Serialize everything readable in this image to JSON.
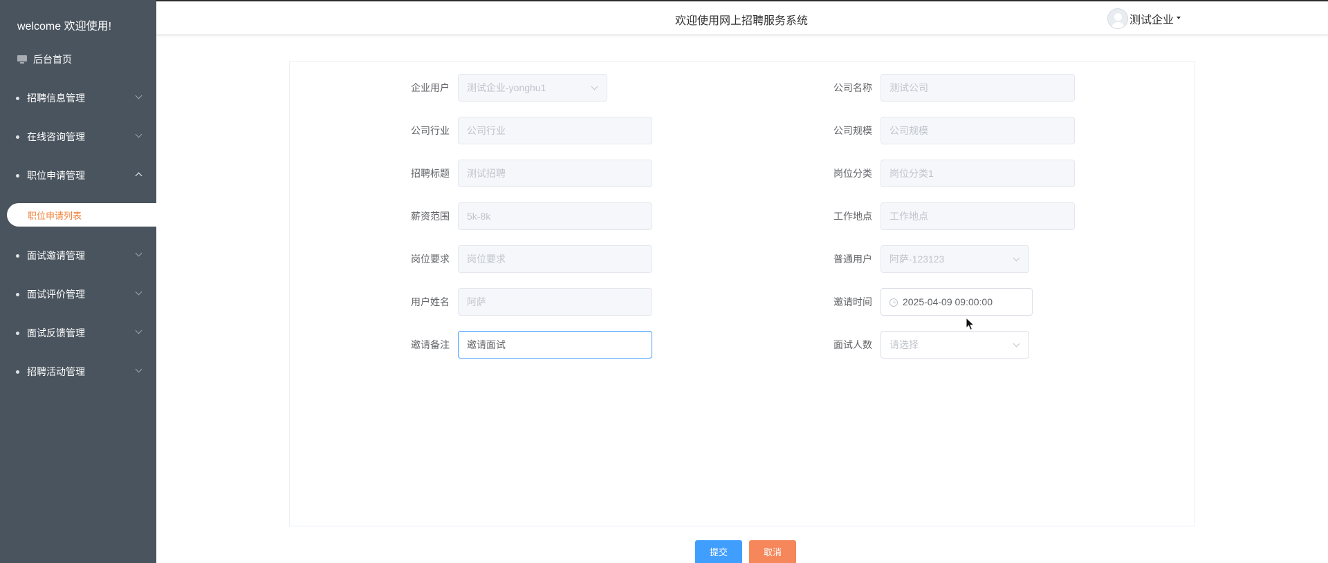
{
  "sidebar": {
    "welcome": "welcome 欢迎使用!",
    "home": "后台首页",
    "menus": [
      {
        "label": "招聘信息管理",
        "expanded": false
      },
      {
        "label": "在线咨询管理",
        "expanded": false
      },
      {
        "label": "职位申请管理",
        "expanded": true
      },
      {
        "label": "面试邀请管理",
        "expanded": false
      },
      {
        "label": "面试评价管理",
        "expanded": false
      },
      {
        "label": "面试反馈管理",
        "expanded": false
      },
      {
        "label": "招聘活动管理",
        "expanded": false
      }
    ],
    "active_sub": "职位申请列表"
  },
  "header": {
    "title": "欢迎使用网上招聘服务系统",
    "user": "测试企业"
  },
  "form": {
    "left": [
      {
        "label": "企业用户",
        "value": "测试企业-yonghu1",
        "type": "select",
        "state": "disabled"
      },
      {
        "label": "公司行业",
        "value": "公司行业",
        "type": "input",
        "state": "placeholder"
      },
      {
        "label": "招聘标题",
        "value": "测试招聘",
        "type": "input",
        "state": "disabled"
      },
      {
        "label": "薪资范围",
        "value": "5k-8k",
        "type": "input",
        "state": "disabled"
      },
      {
        "label": "岗位要求",
        "value": "岗位要求",
        "type": "input",
        "state": "placeholder"
      },
      {
        "label": "用户姓名",
        "value": "阿萨",
        "type": "input",
        "state": "disabled"
      },
      {
        "label": "邀请备注",
        "value": "邀请面试",
        "type": "input",
        "state": "active"
      }
    ],
    "right": [
      {
        "label": "公司名称",
        "value": "测试公司",
        "type": "input",
        "state": "disabled"
      },
      {
        "label": "公司规模",
        "value": "公司规模",
        "type": "input",
        "state": "placeholder"
      },
      {
        "label": "岗位分类",
        "value": "岗位分类1",
        "type": "input",
        "state": "disabled"
      },
      {
        "label": "工作地点",
        "value": "工作地点",
        "type": "input",
        "state": "placeholder"
      },
      {
        "label": "普通用户",
        "value": "阿萨-123123",
        "type": "select",
        "state": "disabled"
      },
      {
        "label": "邀请时间",
        "value": "2025-04-09 09:00:00",
        "type": "datetime",
        "state": "enabled"
      },
      {
        "label": "面试人数",
        "value": "请选择",
        "type": "select",
        "state": "placeholder"
      }
    ]
  },
  "buttons": {
    "submit": "提交",
    "cancel": "取消"
  },
  "colors": {
    "sidebar_bg": "#4a545e",
    "active_accent": "#f2823b",
    "primary": "#409eff",
    "cancel": "#f5875a"
  }
}
